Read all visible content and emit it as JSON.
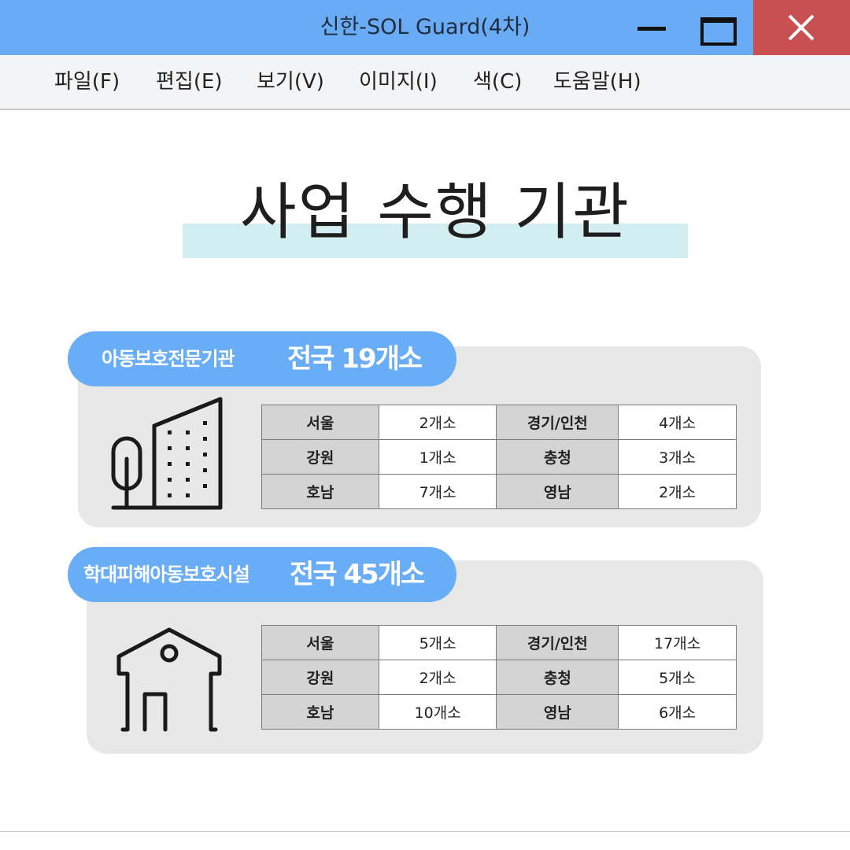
{
  "window": {
    "title": "신한-SOL Guard(4차)",
    "controls": [
      "minimize-icon",
      "maximize-icon",
      "close-icon"
    ]
  },
  "menu": [
    "파일(F)",
    "편집(E)",
    "보기(V)",
    "이미지(I)",
    "색(C)",
    "도움말(H)"
  ],
  "heading": "사업 수행 기관",
  "sections": [
    {
      "name": "아동보호전문기관",
      "count": "전국 19개소",
      "icon": "building-icon",
      "rows": [
        [
          "서울",
          "2개소",
          "경기/인천",
          "4개소"
        ],
        [
          "강원",
          "1개소",
          "충청",
          "3개소"
        ],
        [
          "호남",
          "7개소",
          "영남",
          "2개소"
        ]
      ]
    },
    {
      "name": "학대피해아동보호시설",
      "count": "전국 45개소",
      "icon": "house-icon",
      "rows": [
        [
          "서울",
          "5개소",
          "경기/인천",
          "17개소"
        ],
        [
          "강원",
          "2개소",
          "충청",
          "5개소"
        ],
        [
          "호남",
          "10개소",
          "영남",
          "6개소"
        ]
      ]
    }
  ],
  "colors": {
    "titlebar": "#6aabf5",
    "close_button": "#c85050",
    "pill": "#68adf6",
    "card": "#e8e8e8",
    "heading_highlight": "#d3eef0",
    "key_cell": "#d4d4d4"
  }
}
